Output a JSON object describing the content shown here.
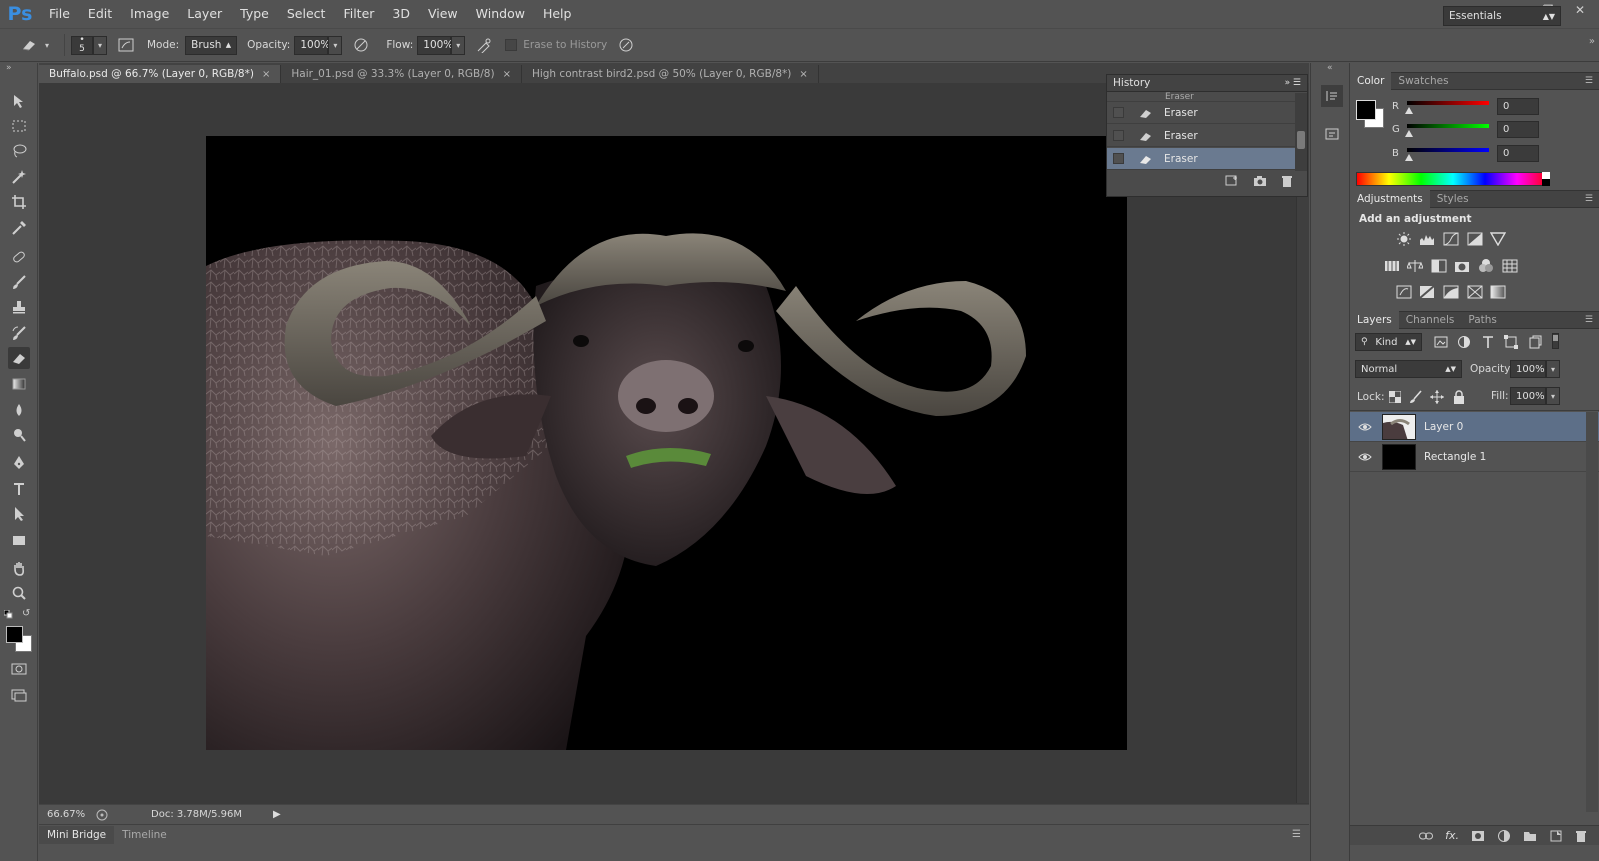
{
  "app": {
    "logo": "Ps"
  },
  "menu": [
    "File",
    "Edit",
    "Image",
    "Layer",
    "Type",
    "Select",
    "Filter",
    "3D",
    "View",
    "Window",
    "Help"
  ],
  "options": {
    "brush_size": "5",
    "mode_label": "Mode:",
    "mode_value": "Brush",
    "opacity_label": "Opacity:",
    "opacity_value": "100%",
    "flow_label": "Flow:",
    "flow_value": "100%",
    "erase_history_label": "Erase to History",
    "workspace": "Essentials"
  },
  "tabs": [
    {
      "label": "Buffalo.psd @ 66.7% (Layer 0, RGB/8*)",
      "close": "×"
    },
    {
      "label": "Hair_01.psd @ 33.3% (Layer 0, RGB/8)",
      "close": "×"
    },
    {
      "label": "High contrast bird2.psd @ 50% (Layer 0, RGB/8*)",
      "close": "×"
    }
  ],
  "history": {
    "title": "History",
    "partial": "Eraser",
    "items": [
      "Eraser",
      "Eraser",
      "Eraser"
    ]
  },
  "status": {
    "zoom": "66.67%",
    "doc": "Doc: 3.78M/5.96M"
  },
  "bottom_tabs": [
    "Mini Bridge",
    "Timeline"
  ],
  "color_panel": {
    "tabs": [
      "Color",
      "Swatches"
    ],
    "channels": [
      {
        "label": "R",
        "value": "0"
      },
      {
        "label": "G",
        "value": "0"
      },
      {
        "label": "B",
        "value": "0"
      }
    ]
  },
  "adjustments": {
    "tabs": [
      "Adjustments",
      "Styles"
    ],
    "heading": "Add an adjustment"
  },
  "layers_panel": {
    "tabs": [
      "Layers",
      "Channels",
      "Paths"
    ],
    "kind": "Kind",
    "blend_mode": "Normal",
    "opacity_label": "Opacity:",
    "opacity_value": "100%",
    "lock_label": "Lock:",
    "fill_label": "Fill:",
    "fill_value": "100%",
    "layers": [
      "Layer 0",
      "Rectangle 1"
    ]
  },
  "colors": {
    "accent": "#3a8ee0",
    "ui_bg": "#535353",
    "canvas_bg": "#3a3a3a",
    "selection": "#5d6f88"
  }
}
